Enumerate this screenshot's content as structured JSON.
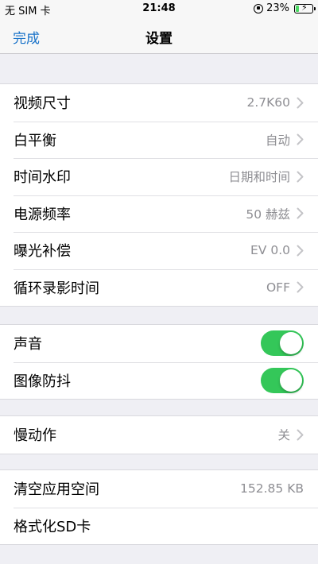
{
  "status_bar": {
    "carrier": "无 SIM 卡",
    "time": "21:48",
    "battery": "23%",
    "battery_level": 0.23,
    "icons": [
      "orientation-lock-icon",
      "battery-charging-icon"
    ]
  },
  "nav": {
    "done_label": "完成",
    "title": "设置"
  },
  "colors": {
    "accent": "#1a73c9",
    "switch_on": "#34c759",
    "secondary_text": "#8e8e93",
    "background": "#efeff4"
  },
  "group1": {
    "rows": [
      {
        "label": "视频尺寸",
        "value": "2.7K60"
      },
      {
        "label": "白平衡",
        "value": "自动"
      },
      {
        "label": "时间水印",
        "value": "日期和时间"
      },
      {
        "label": "电源频率",
        "value": "50 赫兹"
      },
      {
        "label": "曝光补偿",
        "value": "EV 0.0"
      },
      {
        "label": "循环录影时间",
        "value": "OFF"
      }
    ]
  },
  "group2": {
    "rows": [
      {
        "label": "声音",
        "on": true
      },
      {
        "label": "图像防抖",
        "on": true
      }
    ]
  },
  "group3": {
    "rows": [
      {
        "label": "慢动作",
        "value": "关"
      }
    ]
  },
  "group4": {
    "rows": [
      {
        "label": "清空应用空间",
        "value": "152.85 KB"
      },
      {
        "label": "格式化SD卡"
      }
    ]
  }
}
